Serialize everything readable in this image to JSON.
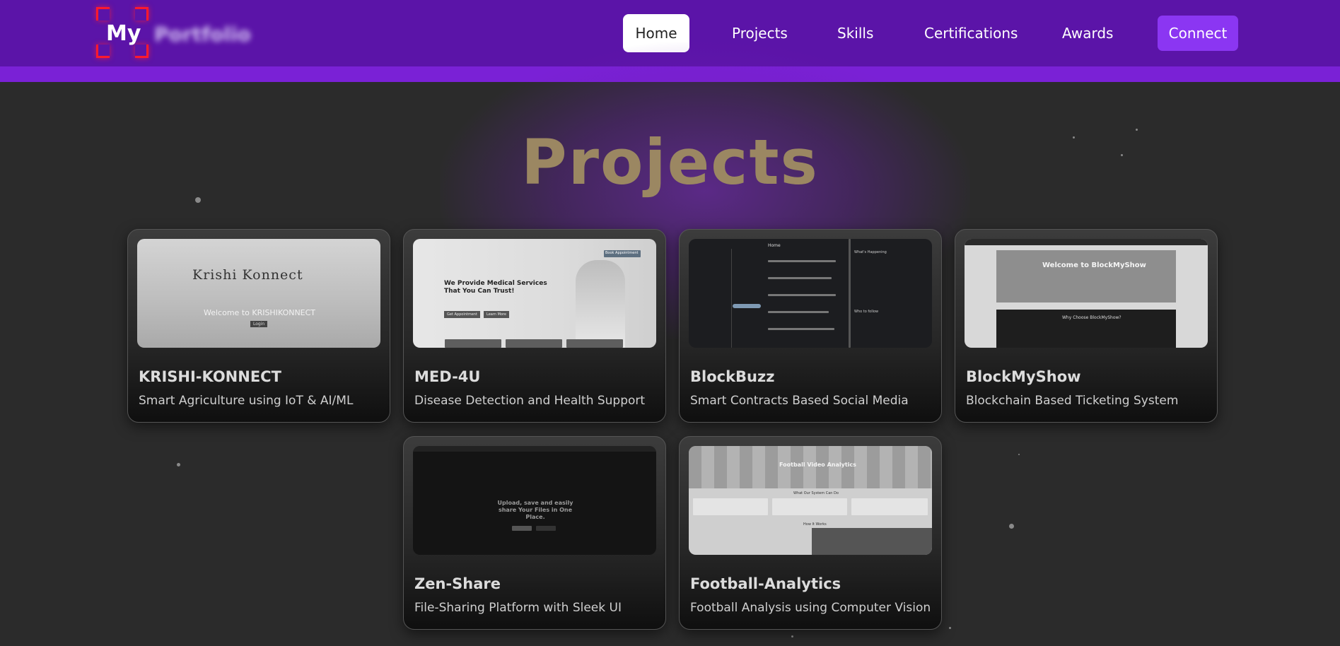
{
  "logo": {
    "prefix": "My",
    "suffix": "Portfolio"
  },
  "nav": {
    "items": [
      "Home",
      "Projects",
      "Skills",
      "Certifications",
      "Awards"
    ],
    "active": "Home",
    "connect_label": "Connect"
  },
  "page": {
    "title": "Projects"
  },
  "projects": [
    {
      "title": "KRISHI-KONNECT",
      "description": "Smart Agriculture using IoT & AI/ML",
      "thumb": {
        "brand": "Krishi Konnect",
        "welcome": "Welcome to KRISHIKONNECT",
        "button": "Login"
      }
    },
    {
      "title": "MED-4U",
      "description": "Disease Detection and Health Support",
      "thumb": {
        "headline": "We Provide Medical Services That You Can Trust!",
        "button1": "Get Appointment",
        "button2": "Learn More",
        "cta": "Book Appointment"
      }
    },
    {
      "title": "BlockBuzz",
      "description": "Smart Contracts Based Social Media",
      "thumb": {
        "feed": "Home",
        "side": "What's Happening",
        "who": "Who to follow"
      }
    },
    {
      "title": "BlockMyShow",
      "description": "Blockchain Based Ticketing System",
      "thumb": {
        "welcome": "Welcome to BlockMyShow",
        "why": "Why Choose BlockMyShow?"
      }
    },
    {
      "title": "Zen-Share",
      "description": "File-Sharing Platform with Sleek UI",
      "thumb": {
        "headline": "Upload, save and easily share Your Files in One Place."
      }
    },
    {
      "title": "Football-Analytics",
      "description": "Football Analysis using Computer Vision",
      "thumb": {
        "headline": "Football Video Analytics",
        "sub": "What Our System Can Do",
        "how": "How It Works"
      }
    }
  ]
}
